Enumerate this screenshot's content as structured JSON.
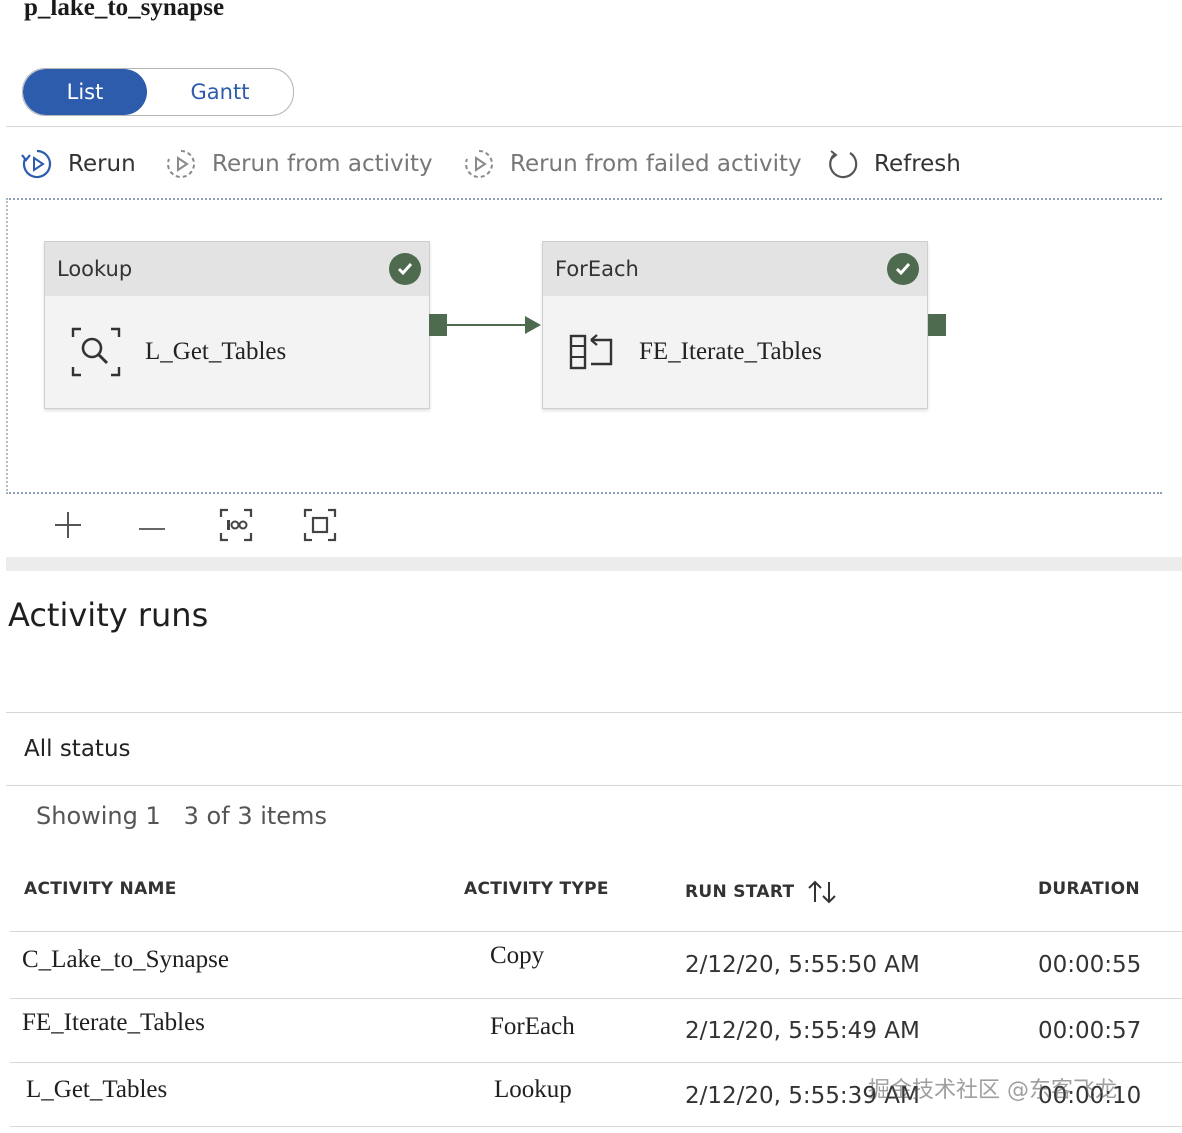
{
  "pipeline": {
    "title": "p_lake_to_synapse"
  },
  "view_toggle": {
    "active": "List",
    "inactive": "Gantt"
  },
  "toolbar": {
    "rerun": "Rerun",
    "rerun_from_activity": "Rerun from activity",
    "rerun_from_failed": "Rerun from failed activity",
    "refresh": "Refresh"
  },
  "canvas": {
    "activities": [
      {
        "type": "Lookup",
        "name": "L_Get_Tables",
        "status": "succeeded",
        "icon": "lookup-icon"
      },
      {
        "type": "ForEach",
        "name": "FE_Iterate_Tables",
        "status": "succeeded",
        "icon": "foreach-icon"
      }
    ],
    "zoom_controls": [
      "zoom-in-icon",
      "zoom-out-icon",
      "zoom-100-icon",
      "fit-to-screen-icon"
    ]
  },
  "activity_runs": {
    "title": "Activity runs",
    "status_filter": "All status",
    "showing": "Showing 1   3 of 3 items",
    "columns": [
      "ACTIVITY NAME",
      "ACTIVITY TYPE",
      "RUN START",
      "DURATION"
    ],
    "rows": [
      {
        "name": "C_Lake_to_Synapse",
        "type": "Copy",
        "run_start": "2/12/20, 5:55:50 AM",
        "duration": "00:00:55"
      },
      {
        "name": "FE_Iterate_Tables",
        "type": "ForEach",
        "run_start": "2/12/20, 5:55:49 AM",
        "duration": "00:00:57"
      },
      {
        "name": "L_Get_Tables",
        "type": "Lookup",
        "run_start": "2/12/20, 5:55:39 AM",
        "duration": "00:00:10"
      }
    ]
  },
  "watermark": "掘金技术社区 @东客飞龙",
  "colors": {
    "accent": "#2e5cad",
    "success": "#4e6b4f",
    "node_header": "#e3e3e3"
  }
}
